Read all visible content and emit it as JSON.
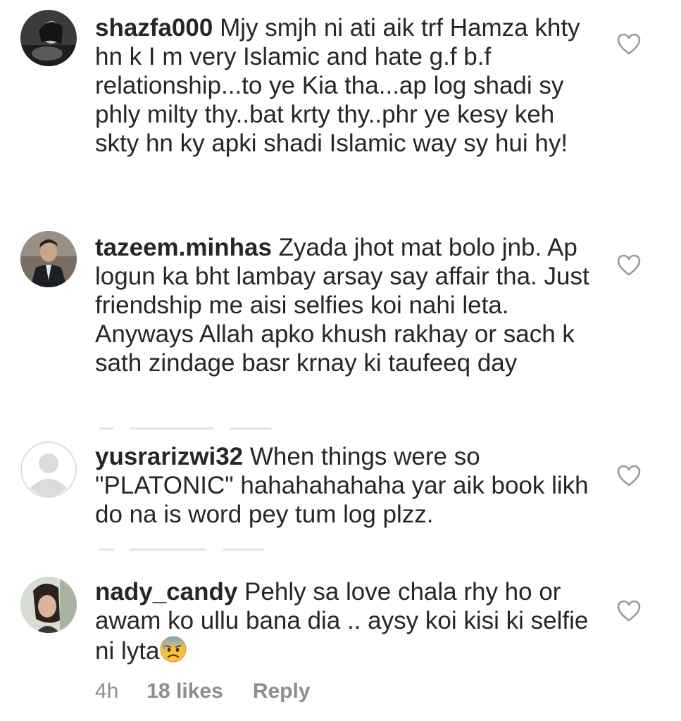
{
  "comments": [
    {
      "username": "shazfa000",
      "text": "Mjy smjh ni ati aik trf Hamza khty hn k I m very Islamic and hate g.f b.f relationship...to ye Kia tha...ap log shadi sy phly milty thy..bat krty thy..phr ye kesy keh skty hn ky apki shadi Islamic way sy hui hy!",
      "avatar_icon": "profile-photo-dark"
    },
    {
      "username": "tazeem.minhas",
      "text": "Zyada jhot mat bolo jnb. Ap logun ka bht lambay arsay say affair tha. Just friendship me aisi selfies koi nahi leta. Anyways Allah apko khush rakhay or sach k sath zindage basr krnay ki taufeeq day",
      "avatar_icon": "profile-photo-man-suit"
    },
    {
      "username": "yusrarizwi32",
      "text": "When things were so \"PLATONIC\" hahahahahaha yar aik book likh do na is word pey tum log plzz.",
      "avatar_icon": "default-avatar-placeholder"
    },
    {
      "username": "nady_candy",
      "text": "Pehly sa love chala rhy ho or awam ko ullu bana dia .. aysy koi kisi ki selfie ni lyta",
      "emoji_icon": "anxious-face-with-sweat-emoji",
      "avatar_icon": "profile-photo-woman",
      "time": "4h",
      "likes": "18 likes",
      "reply_label": "Reply"
    }
  ],
  "icons": {
    "like": "heart-outline-icon"
  },
  "colors": {
    "text": "#262626",
    "meta": "#8e8e8e",
    "heart": "#999999"
  }
}
